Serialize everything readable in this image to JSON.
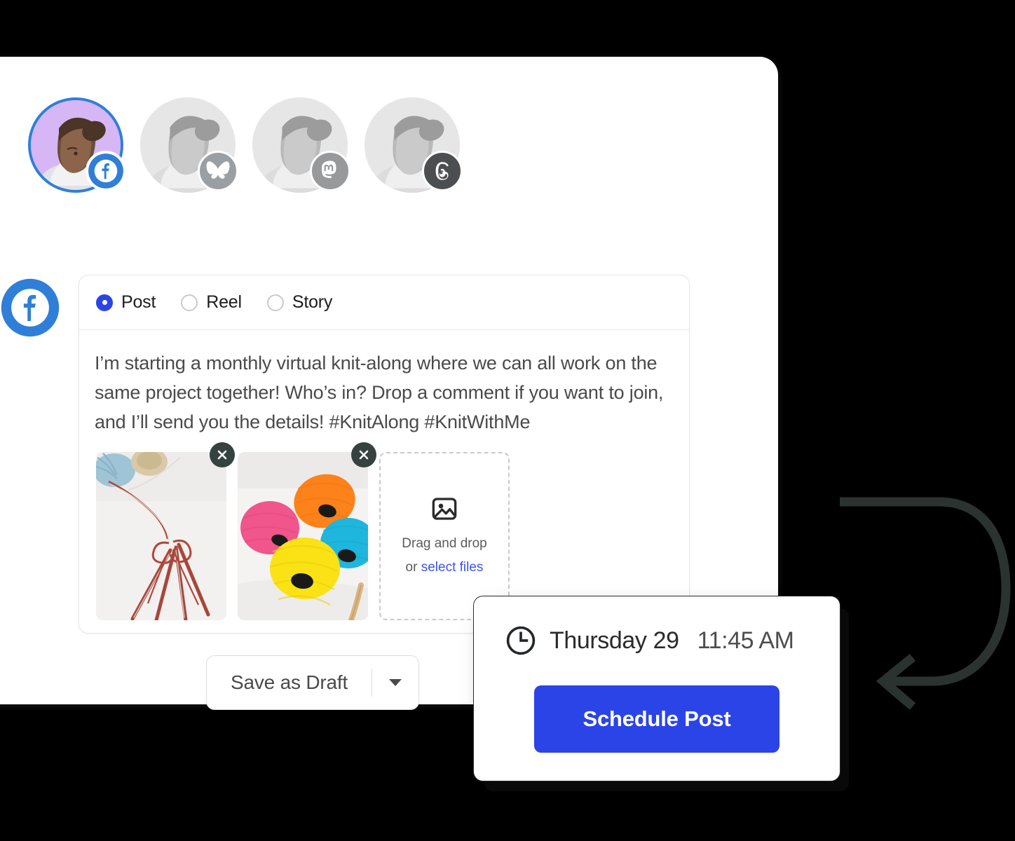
{
  "accounts": [
    {
      "name": "account-facebook",
      "platform": "facebook",
      "platform_label": "Facebook",
      "active": true
    },
    {
      "name": "account-bluesky",
      "platform": "bluesky",
      "platform_label": "Bluesky",
      "active": false
    },
    {
      "name": "account-mastodon",
      "platform": "mastodon",
      "platform_label": "Mastodon",
      "active": false
    },
    {
      "name": "account-threads",
      "platform": "threads",
      "platform_label": "Threads",
      "active": false
    }
  ],
  "composer": {
    "platform_marker": "facebook-icon",
    "post_types": [
      {
        "label": "Post",
        "selected": true
      },
      {
        "label": "Reel",
        "selected": false
      },
      {
        "label": "Story",
        "selected": false
      }
    ],
    "post_text": "I’m starting a monthly virtual knit-along where we can all work on the same project together! Who’s in? Drop a comment if you want to join, and I’ll send you the details! #KnitAlong #KnitWithMe",
    "media": [
      {
        "alt": "knitting needles with red yarn tied in a bow",
        "remove_label": "×"
      },
      {
        "alt": "colorful balls of yarn in pink orange yellow and teal",
        "remove_label": "×"
      }
    ],
    "dropzone": {
      "icon": "image-icon",
      "line1": "Drag and drop",
      "line2_prefix": "or ",
      "line2_link": "select files"
    }
  },
  "actions": {
    "save_draft_label": "Save as Draft",
    "save_draft_caret": "chevron-down-icon"
  },
  "schedule": {
    "clock_icon": "clock-icon",
    "day": "Thursday 29",
    "time": "11:45 AM",
    "button_label": "Schedule Post"
  },
  "colors": {
    "brand_blue": "#2b44e8",
    "facebook_blue": "#2f7fd8",
    "link_blue": "#3b55f0",
    "background": "#000000",
    "panel": "#ffffff"
  }
}
